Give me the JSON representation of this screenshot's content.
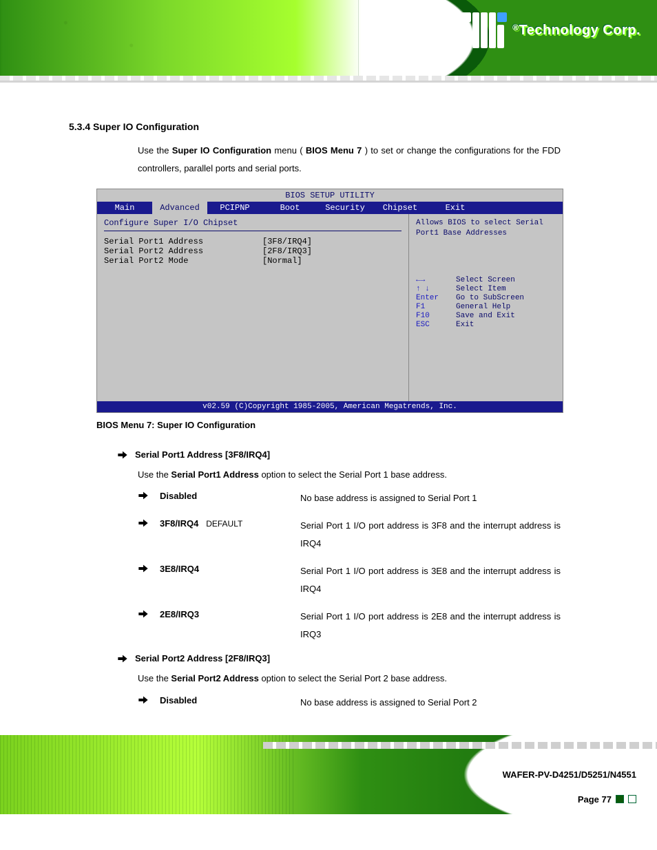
{
  "header": {
    "brand_reg": "®",
    "brand_text": "Technology Corp."
  },
  "section": {
    "number_title": "5.3.4 Super IO Configuration",
    "intro_prefix": "Use  the  ",
    "intro_bold1": "Super IO Configuration",
    "intro_mid": "  menu  (",
    "intro_bold2": "BIOS Menu 7",
    "intro_suffix": ")  to  set  or  change  the configurations for the FDD controllers, parallel ports and serial ports."
  },
  "bios": {
    "top_left": "BIOS SETUP UTILITY",
    "tabs": [
      "Main",
      "Advanced",
      "PCIPNP",
      "Boot",
      "Security",
      "Chipset",
      "Exit"
    ],
    "active": 1,
    "panel_title": "Configure Super I/O Chipset",
    "rows": [
      {
        "lbl": "Serial Port1 Address",
        "val": "[3F8/IRQ4]"
      },
      {
        "lbl": "Serial Port2 Address",
        "val": "[2F8/IRQ3]"
      },
      {
        "lbl": "Serial Port2 Mode",
        "val": "[Normal]"
      }
    ],
    "right_desc": "Allows BIOS to select Serial Port1 Base Addresses",
    "keys": [
      {
        "sym": "←→",
        "txt": "Select Screen"
      },
      {
        "sym": "↑ ↓",
        "txt": "Select Item"
      },
      {
        "sym": "Enter",
        "txt": "Go to SubScreen"
      },
      {
        "sym": "F1",
        "txt": "General Help"
      },
      {
        "sym": "F10",
        "txt": "Save and Exit"
      },
      {
        "sym": "ESC",
        "txt": "Exit"
      }
    ],
    "footer": "v02.59 (C)Copyright 1985-2005, American Megatrends, Inc.",
    "caption": "BIOS Menu 7: Super IO Configuration"
  },
  "defs": [
    {
      "title": "Serial Port1 Address [3F8/IRQ4]",
      "intro_prefix": "Use the ",
      "intro_bold": "Serial Port1 Address",
      "intro_suffix": " option to select the Serial Port 1 base address.",
      "options": [
        {
          "name": "Disabled",
          "desc": "No base address is assigned to Serial Port 1"
        },
        {
          "name": "3F8/IRQ4",
          "tag": "DEFAULT",
          "desc": "Serial Port 1 I/O port address is 3F8 and the interrupt address is IRQ4"
        },
        {
          "name": "3E8/IRQ4",
          "desc": "Serial Port 1 I/O port address is 3E8 and the interrupt address is IRQ4"
        },
        {
          "name": "2E8/IRQ3",
          "desc": "Serial Port 1 I/O port address is 2E8 and the interrupt address is IRQ3"
        }
      ]
    },
    {
      "title": "Serial Port2 Address [2F8/IRQ3]",
      "intro_prefix": "Use the ",
      "intro_bold": "Serial Port2 Address",
      "intro_suffix": " option to select the Serial Port 2 base address.",
      "options": [
        {
          "name": "Disabled",
          "desc": "No base address is assigned to Serial Port 2"
        }
      ]
    }
  ],
  "footer": {
    "product": "WAFER-PV-D4251/D5251/N4551",
    "page_label": "Page 77"
  }
}
